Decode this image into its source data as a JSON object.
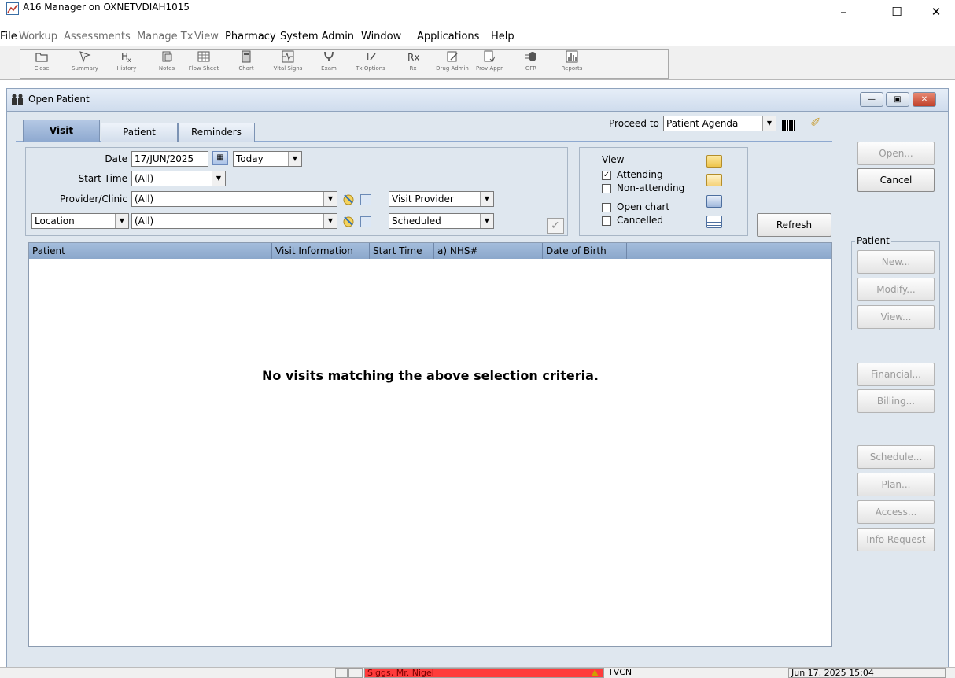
{
  "window": {
    "title": "A16 Manager on OXNETVDIAH1015",
    "controls": {
      "minimize": "–",
      "maximize": "☐",
      "close": "✕"
    }
  },
  "menu": [
    {
      "label": "File",
      "enabled": true
    },
    {
      "label": "Workup",
      "enabled": false
    },
    {
      "label": "Assessments",
      "enabled": false
    },
    {
      "label": "Manage Tx",
      "enabled": false
    },
    {
      "label": "View",
      "enabled": false
    },
    {
      "label": "Pharmacy",
      "enabled": true
    },
    {
      "label": "System Admin",
      "enabled": true
    },
    {
      "label": "Window",
      "enabled": true
    },
    {
      "label": "Applications",
      "enabled": true
    },
    {
      "label": "Help",
      "enabled": true
    }
  ],
  "toolbar": [
    {
      "label": "Close",
      "icon": "folder-icon"
    },
    {
      "label": "Summary",
      "icon": "summary-icon"
    },
    {
      "label": "History",
      "icon": "history-icon"
    },
    {
      "label": "Notes",
      "icon": "notes-icon"
    },
    {
      "label": "Flow Sheet",
      "icon": "flow-sheet-icon"
    },
    {
      "label": "Chart",
      "icon": "chart-icon"
    },
    {
      "label": "Vital Signs",
      "icon": "vital-signs-icon"
    },
    {
      "label": "Exam",
      "icon": "exam-icon"
    },
    {
      "label": "Tx Options",
      "icon": "tx-options-icon"
    },
    {
      "label": "Rx",
      "icon": "rx-icon"
    },
    {
      "label": "Drug Admin",
      "icon": "drug-admin-icon"
    },
    {
      "label": "Prov Appr",
      "icon": "prov-appr-icon"
    },
    {
      "label": "GFR",
      "icon": "gfr-icon"
    },
    {
      "label": "Reports",
      "icon": "reports-icon"
    }
  ],
  "child": {
    "title": "Open Patient",
    "tabs": [
      {
        "label": "Visit",
        "active": true
      },
      {
        "label": "Patient",
        "active": false
      },
      {
        "label": "Reminders",
        "active": false
      }
    ],
    "proceed_to": {
      "label": "Proceed to",
      "value": "Patient Agenda"
    }
  },
  "criteria": {
    "date_label": "Date",
    "date_value": "17/JUN/2025",
    "date_range": "Today",
    "start_time_label": "Start Time",
    "start_time_value": "(All)",
    "provider_label": "Provider/Clinic",
    "provider_value": "(All)",
    "provider_type": "Visit Provider",
    "location_type": "Location",
    "location_value": "(All)",
    "status_value": "Scheduled"
  },
  "view": {
    "title": "View",
    "options": [
      {
        "label": "Attending",
        "checked": true
      },
      {
        "label": "Non-attending",
        "checked": false
      },
      {
        "label": "Open chart",
        "checked": false
      },
      {
        "label": "Cancelled",
        "checked": false
      }
    ],
    "refresh_label": "Refresh"
  },
  "grid": {
    "columns": [
      "Patient",
      "Visit Information",
      "Start Time",
      "a) NHS#",
      "Date of Birth",
      ""
    ],
    "empty_message": "No visits matching the above selection criteria."
  },
  "side_buttons": {
    "open": "Open...",
    "cancel": "Cancel",
    "patient_group": "Patient",
    "new": "New...",
    "modify": "Modify...",
    "view": "View...",
    "financial": "Financial...",
    "billing": "Billing...",
    "schedule": "Schedule...",
    "plan": "Plan...",
    "access": "Access...",
    "info_request": "Info Request"
  },
  "status": {
    "patient": "Siggs, Mr. Nigel",
    "site": "TVCN",
    "datetime": "Jun 17, 2025 15:04",
    "patient_color": "#ff3b3b"
  }
}
